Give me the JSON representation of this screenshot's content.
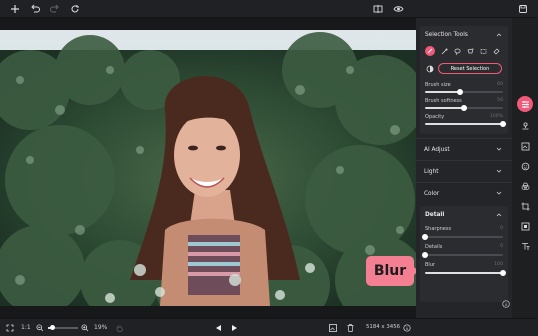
{
  "toolbar": {
    "icons": [
      "add-icon",
      "undo-icon",
      "redo-icon",
      "reset-icon",
      "compare-icon",
      "preview-eye-icon",
      "save-icon"
    ]
  },
  "panel": {
    "selection": {
      "title": "Selection Tools",
      "reset_label": "Reset Selection",
      "brush_size_label": "Brush size",
      "brush_size_value": "60",
      "brush_size": 0.45,
      "brush_softness_label": "Brush softness",
      "brush_softness_value": "50",
      "brush_softness": 0.5,
      "opacity_label": "Opacity",
      "opacity_value": "100%",
      "opacity": 1.0
    },
    "sections": {
      "ai_adjust": "AI Adjust",
      "light": "Light",
      "color": "Color"
    },
    "detail": {
      "title": "Detail",
      "sharpness_label": "Sharpness",
      "sharpness_value": "0",
      "details_label": "Details",
      "details_value": "0",
      "blur_label": "Blur",
      "blur_value": "100",
      "blur": 1.0
    }
  },
  "callout": {
    "label": "Blur"
  },
  "bottom": {
    "zoom_ratio": "1:1",
    "zoom_percent": "19%",
    "dimensions": "5184 x 3456"
  },
  "colors": {
    "accent": "#f05a78",
    "panel_bg": "#242528",
    "callout_bg": "#f47f93"
  }
}
